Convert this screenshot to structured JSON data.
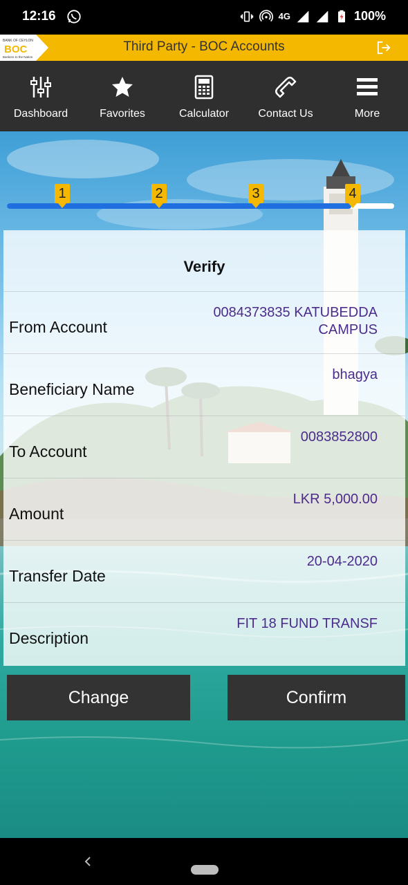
{
  "status_bar": {
    "time": "12:16",
    "network": "4G",
    "battery": "100%"
  },
  "header": {
    "title": "Third Party - BOC Accounts",
    "logo_top": "BANK OF CEYLON",
    "logo_text": "BOC",
    "logo_tagline": "Bankers to the Nation"
  },
  "nav": {
    "items": [
      {
        "label": "Dashboard",
        "icon": "sliders-icon"
      },
      {
        "label": "Favorites",
        "icon": "star-icon"
      },
      {
        "label": "Calculator",
        "icon": "calculator-icon"
      },
      {
        "label": "Contact Us",
        "icon": "phone-icon"
      },
      {
        "label": "More",
        "icon": "menu-icon"
      }
    ]
  },
  "progress": {
    "steps": [
      "1",
      "2",
      "3",
      "4"
    ],
    "current_step": 4,
    "fill_fraction": 0.89
  },
  "verify": {
    "title": "Verify",
    "rows": [
      {
        "label": "From Account",
        "value": "0084373835 KATUBEDDA CAMPUS"
      },
      {
        "label": "Beneficiary Name",
        "value": "bhagya"
      },
      {
        "label": "To Account",
        "value": "0083852800"
      },
      {
        "label": "Amount",
        "value": "LKR 5,000.00"
      },
      {
        "label": "Transfer Date",
        "value": "20-04-2020"
      },
      {
        "label": "Description",
        "value": "FIT 18 FUND TRANSF"
      }
    ]
  },
  "actions": {
    "change_label": "Change",
    "confirm_label": "Confirm"
  },
  "colors": {
    "brand_yellow": "#f5b800",
    "nav_dark": "#2f2f2f",
    "progress_blue": "#1f6fe0",
    "value_purple": "#4b2c8c"
  }
}
